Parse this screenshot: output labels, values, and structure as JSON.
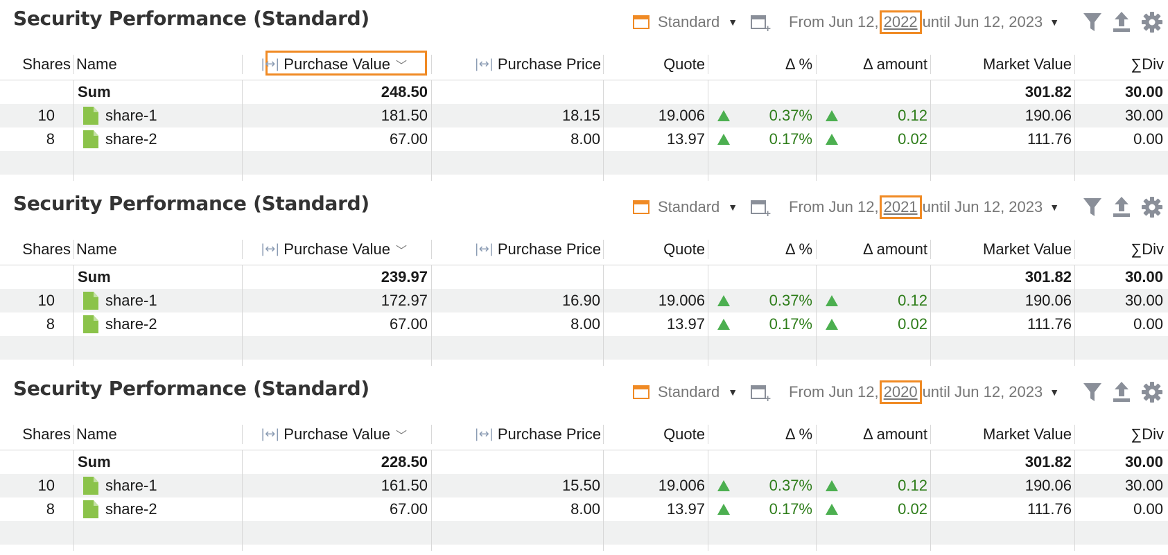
{
  "panels": [
    {
      "title": "Security Performance (Standard)",
      "view_label": "Standard",
      "period_prefix": "From Jun 12,",
      "period_year": "2022",
      "period_suffix": "until Jun 12, 2023",
      "columns": {
        "shares": "Shares",
        "name": "Name",
        "purchase_value": "Purchase Value",
        "purchase_price": "Purchase Price",
        "quote": "Quote",
        "delta_pct": "Δ %",
        "delta_amount": "Δ amount",
        "market_value": "Market Value",
        "div": "∑Div"
      },
      "sum": {
        "label": "Sum",
        "purchase_value": "248.50",
        "market_value": "301.82",
        "div": "30.00"
      },
      "rows": [
        {
          "shares": "10",
          "name": "share-1",
          "purchase_value": "181.50",
          "purchase_price": "18.15",
          "quote": "19.006",
          "delta_pct": "0.37%",
          "delta_amount": "0.12",
          "market_value": "190.06",
          "div": "30.00"
        },
        {
          "shares": "8",
          "name": "share-2",
          "purchase_value": "67.00",
          "purchase_price": "8.00",
          "quote": "13.97",
          "delta_pct": "0.17%",
          "delta_amount": "0.02",
          "market_value": "111.76",
          "div": "0.00"
        }
      ]
    },
    {
      "title": "Security Performance (Standard)",
      "view_label": "Standard",
      "period_prefix": "From Jun 12,",
      "period_year": "2021",
      "period_suffix": "until Jun 12, 2023",
      "columns": {
        "shares": "Shares",
        "name": "Name",
        "purchase_value": "Purchase Value",
        "purchase_price": "Purchase Price",
        "quote": "Quote",
        "delta_pct": "Δ %",
        "delta_amount": "Δ amount",
        "market_value": "Market Value",
        "div": "∑Div"
      },
      "sum": {
        "label": "Sum",
        "purchase_value": "239.97",
        "market_value": "301.82",
        "div": "30.00"
      },
      "rows": [
        {
          "shares": "10",
          "name": "share-1",
          "purchase_value": "172.97",
          "purchase_price": "16.90",
          "quote": "19.006",
          "delta_pct": "0.37%",
          "delta_amount": "0.12",
          "market_value": "190.06",
          "div": "30.00"
        },
        {
          "shares": "8",
          "name": "share-2",
          "purchase_value": "67.00",
          "purchase_price": "8.00",
          "quote": "13.97",
          "delta_pct": "0.17%",
          "delta_amount": "0.02",
          "market_value": "111.76",
          "div": "0.00"
        }
      ]
    },
    {
      "title": "Security Performance (Standard)",
      "view_label": "Standard",
      "period_prefix": "From Jun 12,",
      "period_year": "2020",
      "period_suffix": "until Jun 12, 2023",
      "columns": {
        "shares": "Shares",
        "name": "Name",
        "purchase_value": "Purchase Value",
        "purchase_price": "Purchase Price",
        "quote": "Quote",
        "delta_pct": "Δ %",
        "delta_amount": "Δ amount",
        "market_value": "Market Value",
        "div": "∑Div"
      },
      "sum": {
        "label": "Sum",
        "purchase_value": "228.50",
        "market_value": "301.82",
        "div": "30.00"
      },
      "rows": [
        {
          "shares": "10",
          "name": "share-1",
          "purchase_value": "161.50",
          "purchase_price": "15.50",
          "quote": "19.006",
          "delta_pct": "0.37%",
          "delta_amount": "0.12",
          "market_value": "190.06",
          "div": "30.00"
        },
        {
          "shares": "8",
          "name": "share-2",
          "purchase_value": "67.00",
          "purchase_price": "8.00",
          "quote": "13.97",
          "delta_pct": "0.17%",
          "delta_amount": "0.02",
          "market_value": "111.76",
          "div": "0.00"
        }
      ]
    }
  ],
  "icons": {
    "calendar": "calendar-icon",
    "new_view": "new-view-icon",
    "filter": "filter-icon",
    "export": "export-icon",
    "settings": "gear-icon",
    "resize": "column-resize-icon",
    "sort": "sort-chevron-icon",
    "file": "file-icon",
    "up": "up-arrow-icon"
  },
  "colors": {
    "highlight": "#f08a24",
    "positive": "#2e7d1a",
    "up_arrow": "#4caf50",
    "security_icon": "#8bc34a"
  }
}
